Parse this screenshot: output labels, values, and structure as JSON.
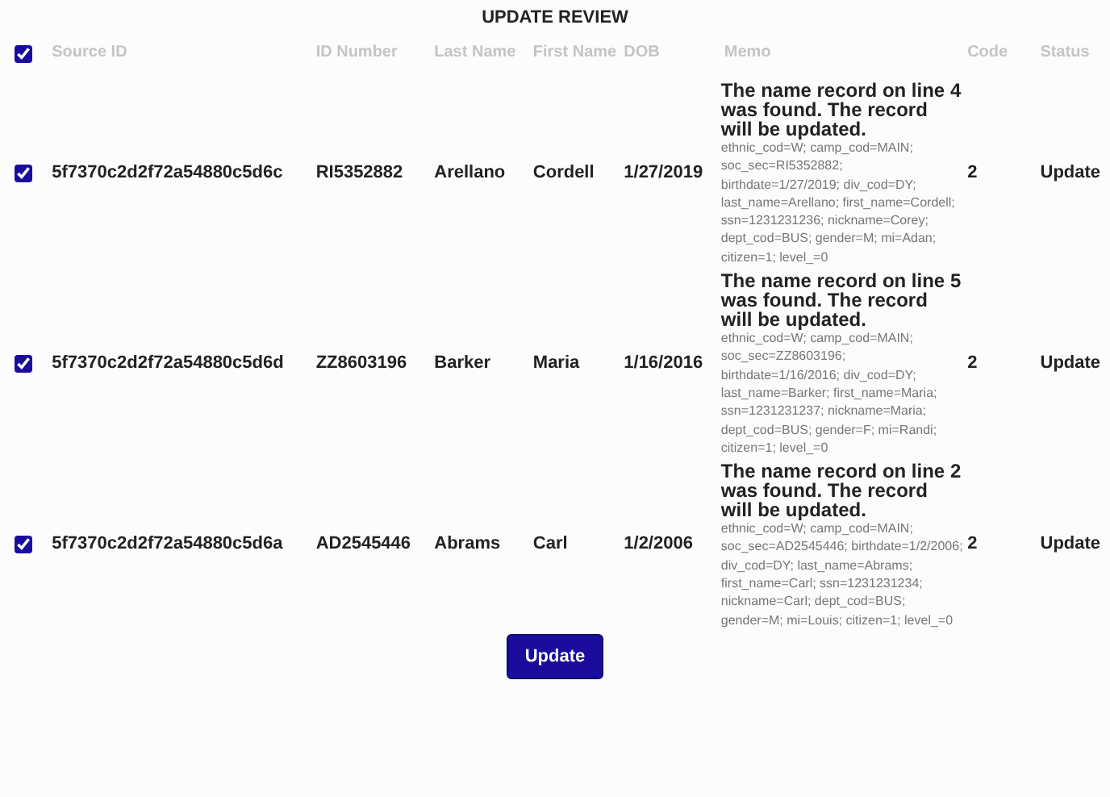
{
  "title": "UPDATE REVIEW",
  "table": {
    "select_all": {
      "checked": true
    },
    "columns": [
      "Source ID",
      "ID Number",
      "Last Name",
      "First Name",
      "DOB",
      "Memo",
      "Code",
      "Status"
    ],
    "rows": [
      {
        "checked": true,
        "source_id": "5f7370c2d2f72a54880c5d6c",
        "id_number": "RI5352882",
        "last_name": "Arellano",
        "first_name": "Cordell",
        "dob": "1/27/2019",
        "memo_title": "The name record on line 4 was found. The record will be updated.",
        "memo_detail": "ethnic_cod=W; camp_cod=MAIN; soc_sec=RI5352882; birthdate=1/27/2019; div_cod=DY; last_name=Arellano; first_name=Cordell; ssn=1231231236; nickname=Corey; dept_cod=BUS; gender=M; mi=Adan; citizen=1; level_=0",
        "code": "2",
        "status": "Update"
      },
      {
        "checked": true,
        "source_id": "5f7370c2d2f72a54880c5d6d",
        "id_number": "ZZ8603196",
        "last_name": "Barker",
        "first_name": "Maria",
        "dob": "1/16/2016",
        "memo_title": "The name record on line 5 was found. The record will be updated.",
        "memo_detail": "ethnic_cod=W; camp_cod=MAIN; soc_sec=ZZ8603196; birthdate=1/16/2016; div_cod=DY; last_name=Barker; first_name=Maria; ssn=1231231237; nickname=Maria; dept_cod=BUS; gender=F; mi=Randi; citizen=1; level_=0",
        "code": "2",
        "status": "Update"
      },
      {
        "checked": true,
        "source_id": "5f7370c2d2f72a54880c5d6a",
        "id_number": "AD2545446",
        "last_name": "Abrams",
        "first_name": "Carl",
        "dob": "1/2/2006",
        "memo_title": "The name record on line 2 was found. The record will be updated.",
        "memo_detail": "ethnic_cod=W; camp_cod=MAIN; soc_sec=AD2545446; birthdate=1/2/2006; div_cod=DY; last_name=Abrams; first_name=Carl; ssn=1231231234; nickname=Carl; dept_cod=BUS; gender=M; mi=Louis; citizen=1; level_=0",
        "code": "2",
        "status": "Update"
      }
    ]
  },
  "button": "Update"
}
